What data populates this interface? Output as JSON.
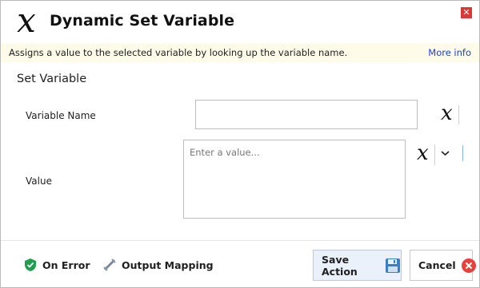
{
  "dialog": {
    "title": "Dynamic Set Variable",
    "title_icon": "variable-x-icon",
    "close_icon": "close-icon"
  },
  "infobar": {
    "description": "Assigns a value to the selected variable by looking up the variable name.",
    "more_info": "More info"
  },
  "form": {
    "section_title": "Set Variable",
    "variable_name": {
      "label": "Variable Name",
      "value": "",
      "icon": "variable-x-icon"
    },
    "value": {
      "label": "Value",
      "value": "",
      "placeholder": "Enter a value...",
      "icon": "variable-x-icon",
      "dropdown_icon": "chevron-down-icon"
    }
  },
  "footer": {
    "on_error": {
      "label": "On Error",
      "icon": "shield-check-icon"
    },
    "output_mapping": {
      "label": "Output Mapping",
      "icon": "plug-connector-icon"
    },
    "save": {
      "label": "Save Action",
      "icon": "floppy-disk-icon"
    },
    "cancel": {
      "label": "Cancel",
      "icon": "cancel-circle-icon"
    }
  },
  "colors": {
    "infobar_bg": "#fefbe9",
    "link": "#1a43c9",
    "close_red": "#d9383a",
    "shield_green": "#1e9e4e",
    "save_bg": "#eaf1fb",
    "floppy_blue": "#3a7fc1",
    "cancel_red": "#e8403d"
  }
}
